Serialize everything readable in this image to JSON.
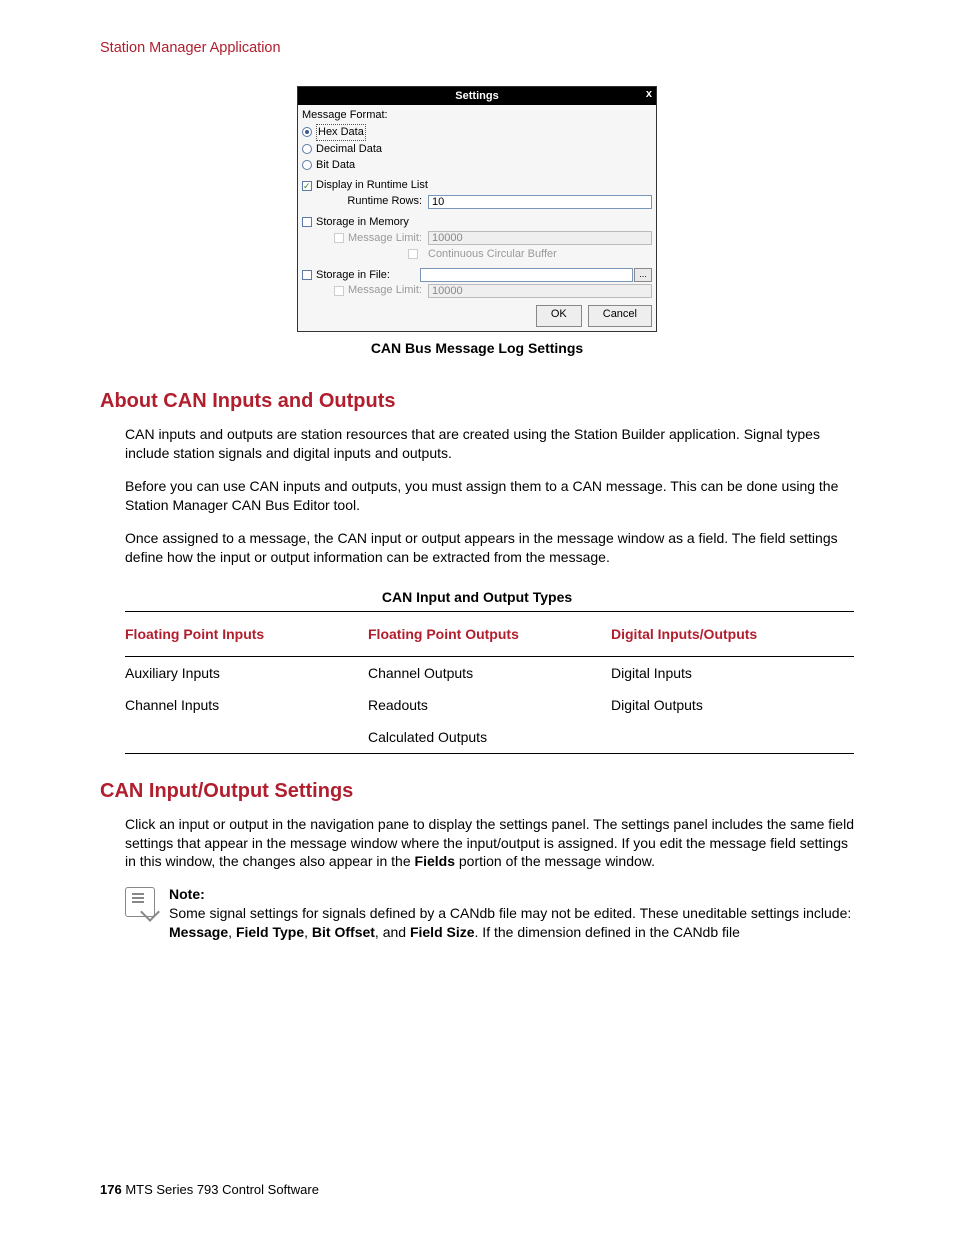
{
  "header": "Station Manager Application",
  "dialog": {
    "title": "Settings",
    "close_label": "x",
    "message_format_label": "Message Format:",
    "hex_label": "Hex Data",
    "decimal_label": "Decimal Data",
    "bit_label": "Bit Data",
    "display_runtime_label": "Display in Runtime List",
    "runtime_rows_label": "Runtime Rows:",
    "runtime_rows_value": "10",
    "storage_memory_label": "Storage in Memory",
    "message_limit_label": "Message Limit:",
    "message_limit_memory_value": "10000",
    "circular_buffer_label": "Continuous Circular Buffer",
    "storage_file_label": "Storage in File:",
    "message_limit_file_value": "10000",
    "browse_label": "...",
    "ok_label": "OK",
    "cancel_label": "Cancel"
  },
  "figcap": "CAN Bus Message Log Settings",
  "h1": "About CAN Inputs and Outputs",
  "p1": "CAN inputs and outputs are station resources that are created using the Station Builder application. Signal types include station signals and digital inputs and outputs.",
  "p2": "Before you can use CAN inputs and outputs, you must assign them to a CAN message. This can be done using the Station Manager CAN Bus Editor tool.",
  "p3": "Once assigned to a message, the CAN input or output appears in the message window as a field. The field settings define how the input or output information can be extracted from the message.",
  "tablecap": "CAN Input and Output Types",
  "table": {
    "headers": [
      "Floating Point Inputs",
      "Floating Point Outputs",
      "Digital Inputs/Outputs"
    ],
    "rows": [
      [
        "Auxiliary Inputs",
        "Channel Outputs",
        "Digital Inputs"
      ],
      [
        "Channel Inputs",
        "Readouts",
        "Digital Outputs"
      ],
      [
        "",
        "Calculated Outputs",
        ""
      ]
    ]
  },
  "h2": "CAN Input/Output Settings",
  "p4a": "Click an input or output in the navigation pane to display the settings panel. The settings panel includes the same field settings that appear in the message window where the input/output is assigned. If you edit the message field settings in this window, the changes also appear in the ",
  "p4b": "Fields",
  "p4c": " portion of the message window.",
  "note_label": "Note:",
  "note_a": "Some signal settings for signals defined by a CANdb file may not be edited. These uneditable settings include: ",
  "note_b1": "Message",
  "note_s1": ", ",
  "note_b2": "Field Type",
  "note_s2": ", ",
  "note_b3": "Bit Offset",
  "note_s3": ", and ",
  "note_b4": "Field Size",
  "note_c": ". If the dimension defined in the CANdb file",
  "footer_page": "176",
  "footer_text": "  MTS Series 793 Control Software"
}
